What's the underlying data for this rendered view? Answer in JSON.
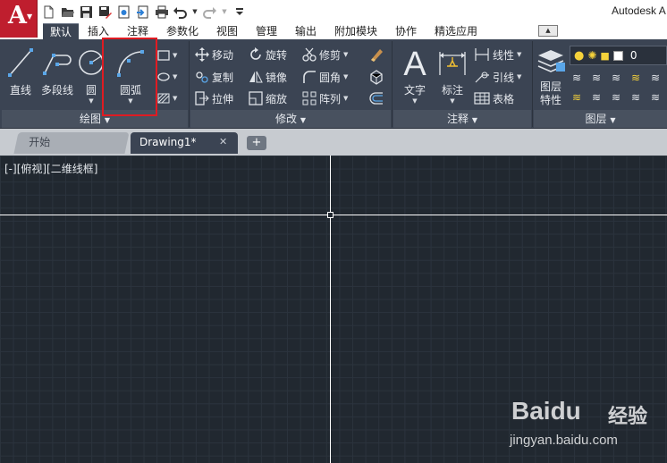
{
  "app": {
    "title": "Autodesk A",
    "menu_letter": "A"
  },
  "quick_access": [
    "new-icon",
    "open-icon",
    "save-icon",
    "save-as-icon",
    "web-icon",
    "export-icon",
    "print-icon",
    "undo-icon",
    "redo-icon",
    "customize-icon"
  ],
  "ribbon_tabs": [
    {
      "label": "默认",
      "active": true
    },
    {
      "label": "插入"
    },
    {
      "label": "注释"
    },
    {
      "label": "参数化"
    },
    {
      "label": "视图"
    },
    {
      "label": "管理"
    },
    {
      "label": "输出"
    },
    {
      "label": "附加模块"
    },
    {
      "label": "协作"
    },
    {
      "label": "精选应用"
    }
  ],
  "draw_panel": {
    "title": "绘图",
    "tools": {
      "line": "直线",
      "polyline": "多段线",
      "circle": "圆",
      "arc": "圆弧"
    }
  },
  "modify_panel": {
    "title": "修改",
    "tools": {
      "move": "移动",
      "rotate": "旋转",
      "trim": "修剪",
      "copy": "复制",
      "mirror": "镜像",
      "fillet": "圆角",
      "stretch": "拉伸",
      "scale": "缩放",
      "array": "阵列"
    }
  },
  "annotation_panel": {
    "title": "注释",
    "tools": {
      "text": "文字",
      "dimension": "标注",
      "linear": "线性",
      "leader": "引线",
      "table": "表格"
    }
  },
  "layers_panel": {
    "title": "图层",
    "properties_line1": "图层",
    "properties_line2": "特性",
    "current_layer": "0"
  },
  "document_tabs": {
    "start": "开始",
    "drawing": "Drawing1*",
    "new_symbol": "+"
  },
  "viewport": {
    "label": "[-][俯视][二维线框]"
  },
  "watermark": {
    "brand": "Baidu",
    "product": "经验",
    "url": "jingyan.baidu.com"
  },
  "colors": {
    "ribbon": "#3b4453",
    "canvas": "#212830",
    "app_button": "#bf1e2e",
    "highlight": "#e01b22"
  }
}
